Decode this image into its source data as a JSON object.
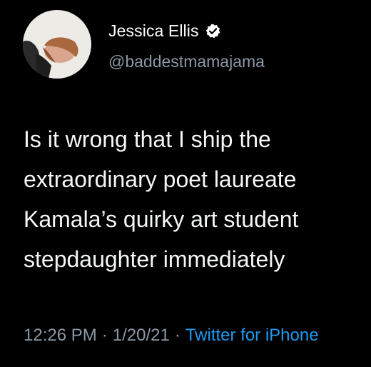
{
  "user": {
    "display_name": "Jessica Ellis",
    "handle": "@baddestmamajama",
    "verified": true,
    "avatar_icon": "profile-photo"
  },
  "tweet": {
    "lines": [
      "Is it wrong that I ship the",
      "extraordinary  poet laureate",
      "Kamala’s quirky art student",
      "stepdaughter immediately"
    ]
  },
  "meta": {
    "time": "12:26 PM",
    "separator": "·",
    "date": "1/20/21",
    "source": "Twitter for iPhone"
  },
  "colors": {
    "background": "#000000",
    "text": "#ffffff",
    "secondary": "#8b98a5",
    "accent": "#1d9bf0"
  }
}
